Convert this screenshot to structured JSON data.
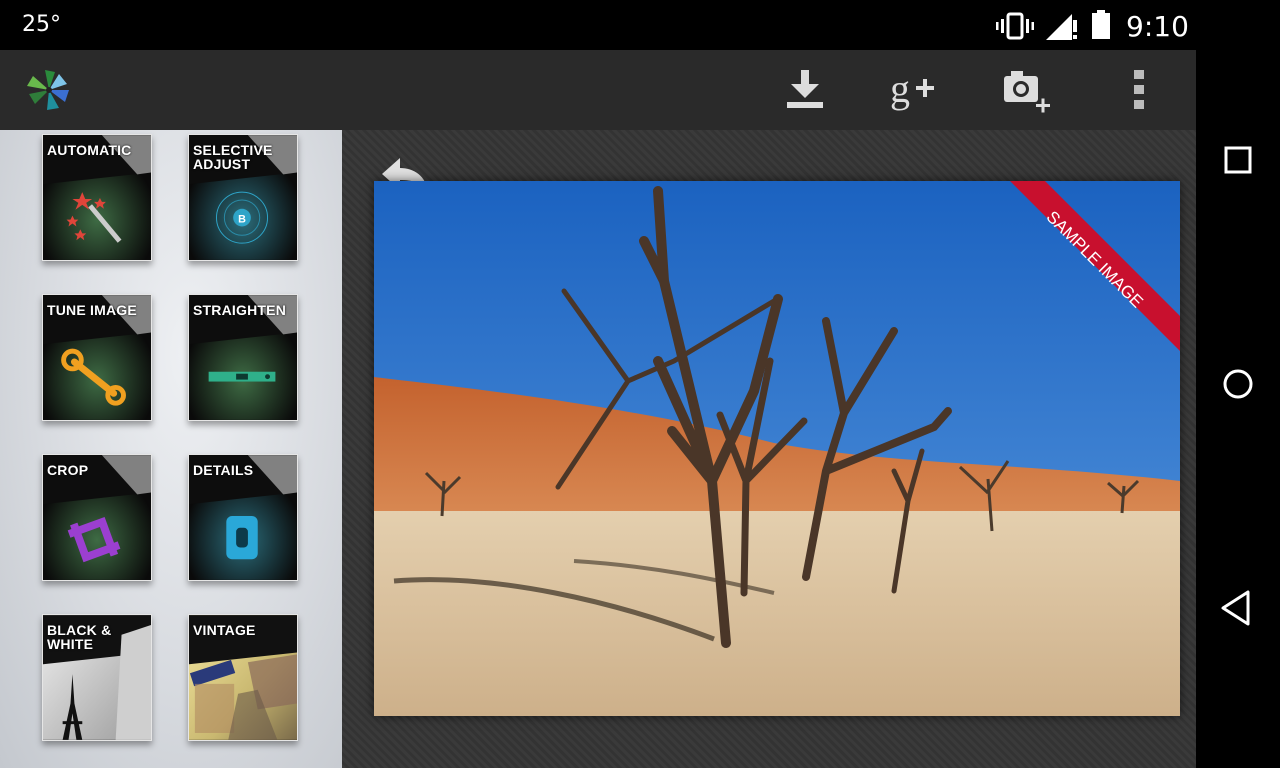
{
  "status_bar": {
    "temperature": "25°",
    "time": "9:10",
    "icons": [
      "vibrate-icon",
      "signal-no-data-icon",
      "battery-icon"
    ]
  },
  "action_bar": {
    "app_logo": "snapseed-logo",
    "actions": [
      {
        "name": "save",
        "icon": "download-icon"
      },
      {
        "name": "share-google-plus",
        "icon": "google-plus-icon"
      },
      {
        "name": "open-photo",
        "icon": "camera-add-icon"
      },
      {
        "name": "overflow-menu",
        "icon": "more-vert-icon"
      }
    ]
  },
  "tools": [
    {
      "label": "AUTOMATIC",
      "icon": "magic-wand-icon",
      "accent": "#e0453a"
    },
    {
      "label": "SELECTIVE\nADJUST",
      "icon": "control-point-icon",
      "accent": "#2ea4c8"
    },
    {
      "label": "TUNE IMAGE",
      "icon": "wrench-icon",
      "accent": "#f0a020"
    },
    {
      "label": "STRAIGHTEN",
      "icon": "level-icon",
      "accent": "#2fb08a"
    },
    {
      "label": "CROP",
      "icon": "crop-icon",
      "accent": "#9b3fd0"
    },
    {
      "label": "DETAILS",
      "icon": "sharpener-icon",
      "accent": "#2aa8d8"
    },
    {
      "label": "BLACK &\nWHITE",
      "icon": "eiffel-tower-icon",
      "accent": "#ffffff"
    },
    {
      "label": "VINTAGE",
      "icon": "vintage-photo-icon",
      "accent": "#e8c850"
    }
  ],
  "canvas": {
    "ribbon": "SAMPLE IMAGE",
    "undo_icon": "undo-icon"
  },
  "nav_bar": {
    "buttons": [
      {
        "name": "recents",
        "icon": "square-icon"
      },
      {
        "name": "home",
        "icon": "circle-icon"
      },
      {
        "name": "back",
        "icon": "triangle-back-icon"
      }
    ]
  }
}
